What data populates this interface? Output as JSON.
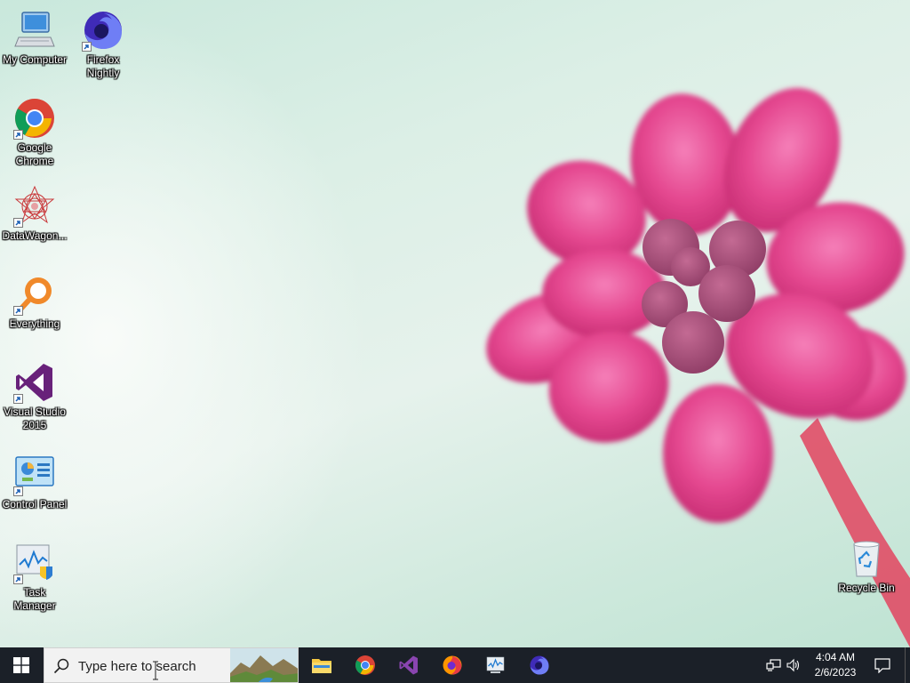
{
  "desktop": {
    "icons": [
      {
        "label": "My Computer",
        "icon": "computer-icon"
      },
      {
        "label": "Firefox Nightly",
        "icon": "firefox-nightly-icon"
      },
      {
        "label": "Google Chrome",
        "icon": "chrome-icon"
      },
      {
        "label": "DataWagon...",
        "icon": "datawagon-icon"
      },
      {
        "label": "Everything",
        "icon": "everything-search-icon"
      },
      {
        "label": "Visual Studio 2015",
        "icon": "visual-studio-icon"
      },
      {
        "label": "Control Panel",
        "icon": "control-panel-icon"
      },
      {
        "label": "Task Manager",
        "icon": "task-manager-icon"
      },
      {
        "label": "Recycle Bin",
        "icon": "recycle-bin-icon"
      }
    ]
  },
  "taskbar": {
    "search_placeholder": "Type here to search",
    "pinned_apps": [
      "file-explorer-icon",
      "chrome-icon",
      "visual-studio-icon",
      "firefox-icon",
      "task-manager-icon",
      "firefox-nightly-icon"
    ],
    "tray_icons": [
      "network-icon",
      "volume-icon"
    ],
    "clock_time": "4:04 AM",
    "clock_date": "2/6/2023",
    "background": "#1b2028",
    "accent": "#0078d7"
  }
}
